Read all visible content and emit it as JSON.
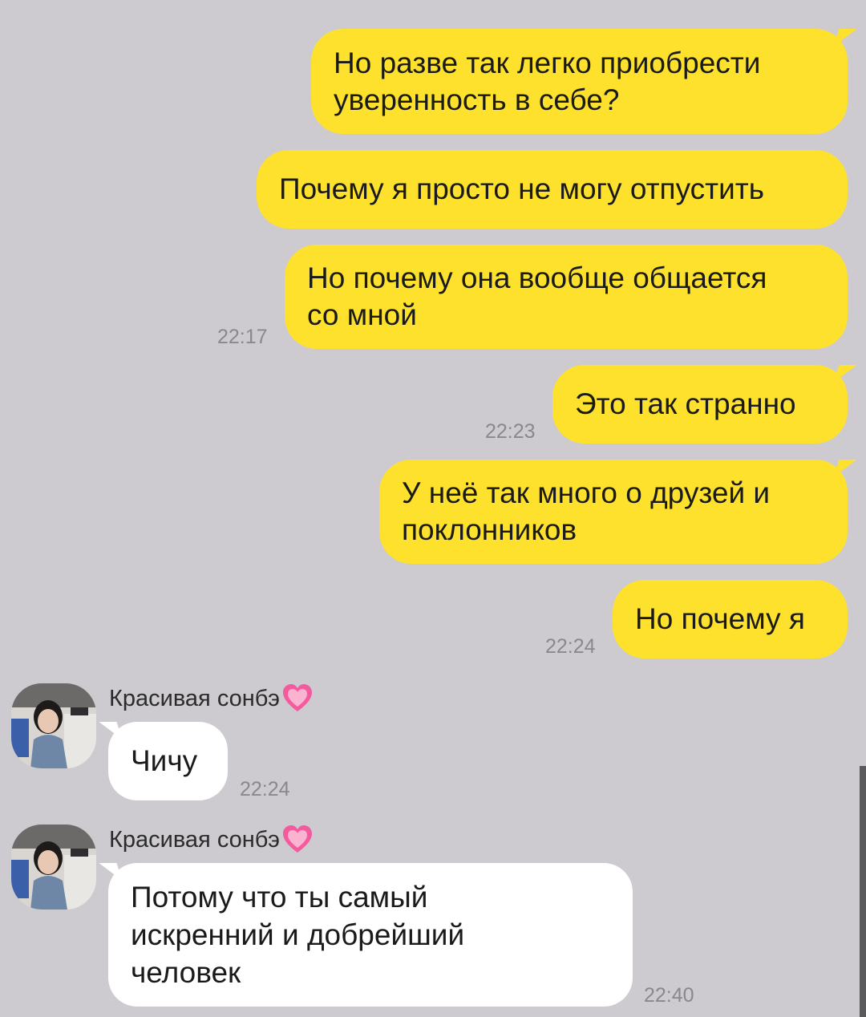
{
  "messages_out": [
    {
      "lines": [
        "Но разве так легко приобрести",
        "уверенность в себе?"
      ],
      "time": ""
    },
    {
      "lines": [
        "Почему я просто не могу отпустить"
      ],
      "time": ""
    },
    {
      "lines": [
        "Но почему она вообще общается",
        "со мной"
      ],
      "time": "22:17"
    },
    {
      "lines": [
        "Это так странно"
      ],
      "time": "22:23"
    },
    {
      "lines": [
        "У неё так много о друзей и",
        "поклонников"
      ],
      "time": ""
    },
    {
      "lines": [
        "Но почему я"
      ],
      "time": "22:24"
    }
  ],
  "messages_in": [
    {
      "sender": "Красивая сонбэ",
      "lines": [
        "Чичу"
      ],
      "time": "22:24"
    },
    {
      "sender": "Красивая сонбэ",
      "lines": [
        "Потому что ты самый",
        "искренний и добрейший",
        "человек"
      ],
      "time": "22:40"
    }
  ],
  "colors": {
    "background": "#cdcbd0",
    "outgoing_bubble": "#fde12c",
    "incoming_bubble": "#ffffff",
    "timestamp": "#8a888c",
    "heart": "#f45b9c"
  },
  "icons": {
    "sender_badge": "pink-heart-icon",
    "avatar": "user-avatar"
  }
}
